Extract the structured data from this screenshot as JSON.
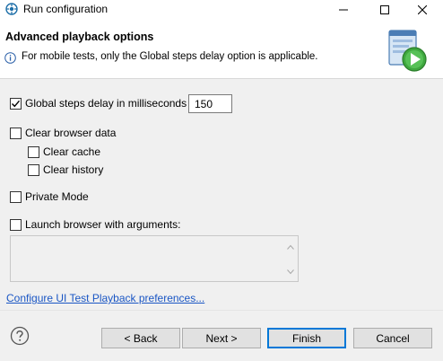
{
  "window": {
    "title": "Run configuration",
    "icon": "run-config-icon"
  },
  "header": {
    "heading": "Advanced playback options",
    "info_text": "For mobile tests, only the Global steps delay option is applicable."
  },
  "options": {
    "global_delay": {
      "label": "Global steps delay in milliseconds",
      "checked": true,
      "value": "150"
    },
    "clear_browser_data": {
      "label": "Clear browser data",
      "checked": false
    },
    "clear_cache": {
      "label": "Clear cache",
      "checked": false
    },
    "clear_history": {
      "label": "Clear history",
      "checked": false
    },
    "private_mode": {
      "label": "Private Mode",
      "checked": false
    },
    "launch_args": {
      "label": "Launch browser with arguments:",
      "checked": false,
      "value": ""
    }
  },
  "link": {
    "label": "Configure UI Test Playback preferences..."
  },
  "buttons": {
    "back": "< Back",
    "next": "Next >",
    "finish": "Finish",
    "cancel": "Cancel"
  },
  "colors": {
    "link": "#1a56c4",
    "default_button_border": "#0078d7",
    "dialog_bg": "#f0f0f0"
  }
}
